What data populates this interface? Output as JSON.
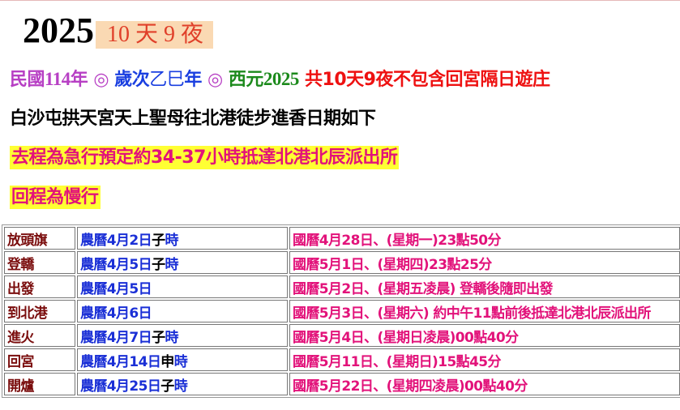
{
  "header": {
    "year": "2025",
    "duration": "10 天 9 夜"
  },
  "intro": {
    "minguo_label": "民國",
    "minguo_year": "114",
    "nian": "年",
    "sep": " ◎ ",
    "suici_label": "歲次",
    "ganzhi": "乙巳",
    "suici_year_char": "年",
    "western_label": "西元",
    "western_year": "2025",
    "summary": " 共10天9夜不包含回宮隔日遊庄"
  },
  "subtitle": "白沙屯拱天宮天上聖母往北港徒步進香日期如下",
  "outbound_note": "去程為急行預定約34-37小時抵達北港北辰派出所",
  "return_note": "回程為慢行",
  "schedule": [
    {
      "event": "放頭旗",
      "lunar": "農曆4月2日",
      "hour": "子",
      "hour_suffix": "時",
      "solar": "國曆4月28日、(星期一)23點50分"
    },
    {
      "event": "登轎",
      "lunar": "農曆4月5日",
      "hour": "子",
      "hour_suffix": "時",
      "solar": "國曆5月1日、(星期四)23點25分"
    },
    {
      "event": "出發",
      "lunar": "農曆4月5日",
      "hour": "",
      "hour_suffix": "",
      "solar": "國曆5月2日、(星期五凌晨) 登轎後隨即出發"
    },
    {
      "event": "到北港",
      "lunar": "農曆4月6日",
      "hour": "",
      "hour_suffix": "",
      "solar": "國曆5月3日、(星期六) 約中午11點前後抵達北港北辰派出所"
    },
    {
      "event": "進火",
      "lunar": "農曆4月7日",
      "hour": "子",
      "hour_suffix": "時",
      "solar": "國曆5月4日、(星期日凌晨)00點40分"
    },
    {
      "event": "回宮",
      "lunar": "農曆4月14日",
      "hour": "申",
      "hour_suffix": "時",
      "solar": "國曆5月11日、(星期日)15點45分"
    },
    {
      "event": "開爐",
      "lunar": "農曆4月25日",
      "hour": "子",
      "hour_suffix": "時",
      "solar": "國曆5月22日、(星期四凌晨)00點40分"
    }
  ]
}
